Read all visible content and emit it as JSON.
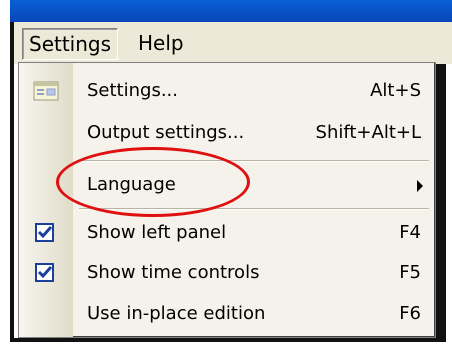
{
  "menubar": {
    "items": [
      {
        "label": "Settings",
        "active": true
      },
      {
        "label": "Help",
        "active": false
      }
    ]
  },
  "dropdown": {
    "items": [
      {
        "label": "Settings...",
        "shortcut": "Alt+S",
        "icon": "settings-window-icon"
      },
      {
        "label": "Output settings...",
        "shortcut": "Shift+Alt+L"
      },
      {
        "label": "Language",
        "submenu": true
      },
      {
        "label": "Show left panel",
        "shortcut": "F4",
        "checked": true,
        "icon": "checkmark-icon"
      },
      {
        "label": "Show time controls",
        "shortcut": "F5",
        "checked": true,
        "icon": "checkmark-icon"
      },
      {
        "label": "Use in-place edition",
        "shortcut": "F6"
      }
    ]
  },
  "colors": {
    "annotation": "#e01010",
    "titlebar": "#0a5fd6",
    "menubar_bg": "#ece9d8"
  }
}
